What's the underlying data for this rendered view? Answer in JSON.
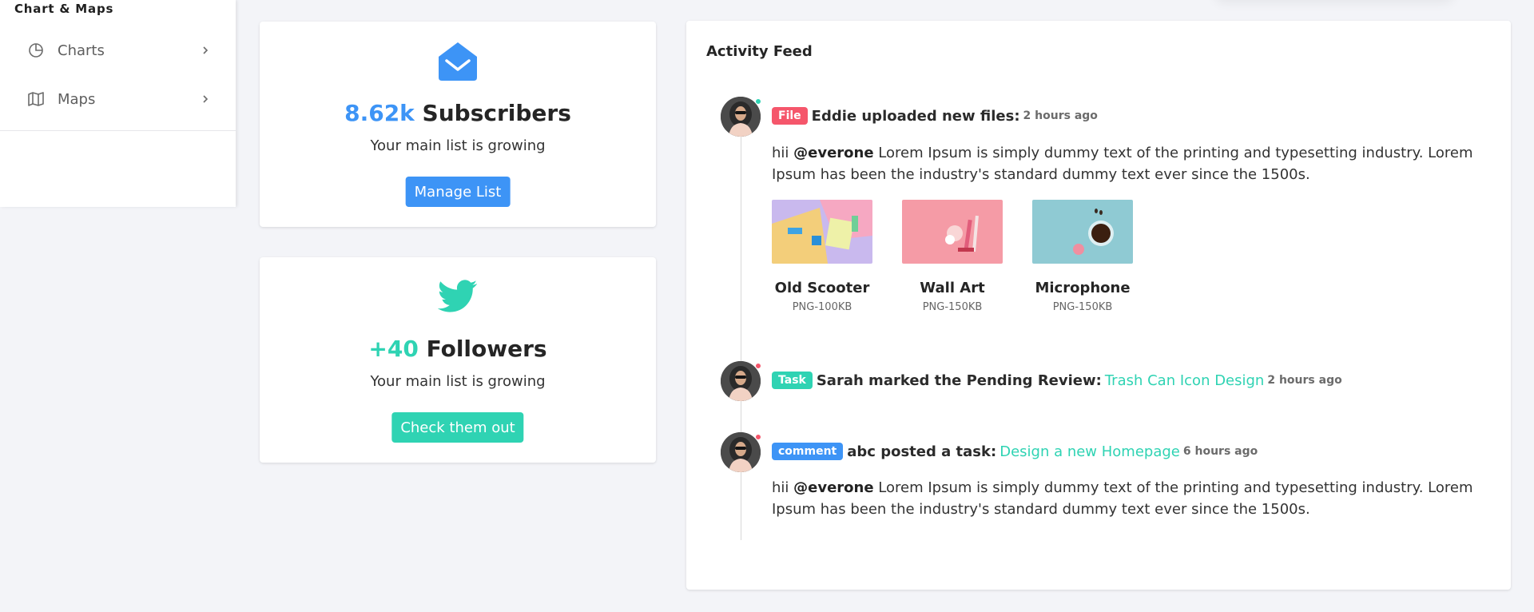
{
  "sidebar": {
    "section_title": "Chart & Maps",
    "items": [
      {
        "label": "Charts",
        "icon": "pie-chart-icon"
      },
      {
        "label": "Maps",
        "icon": "map-icon"
      }
    ]
  },
  "subscribers_card": {
    "icon": "envelope-open-icon",
    "count": "8.62k",
    "count_label": " Subscribers",
    "subtitle": "Your main list is growing",
    "button_label": "Manage List"
  },
  "followers_card": {
    "icon": "twitter-icon",
    "count": "+40",
    "count_label": " Followers",
    "subtitle": "Your main list is growing",
    "button_label": "Check them out"
  },
  "activity_feed": {
    "title": "Activity Feed",
    "entries": [
      {
        "badge": "File",
        "title": "Eddie uploaded new files:",
        "time": "2 hours ago",
        "mention_prefix": "hii ",
        "mention": "@everone",
        "text": " Lorem Ipsum is simply dummy text of the printing and typesetting industry. Lorem Ipsum has been the industry's standard dummy text ever since the 1500s.",
        "files": [
          {
            "name": "Old Scooter",
            "meta": "PNG-100KB"
          },
          {
            "name": "Wall Art",
            "meta": "PNG-150KB"
          },
          {
            "name": "Microphone",
            "meta": "PNG-150KB"
          }
        ]
      },
      {
        "badge": "Task",
        "title": "Sarah marked the Pending Review:",
        "link": "Trash Can Icon Design",
        "time": "2 hours ago"
      },
      {
        "badge": "comment",
        "title": "abc posted a task:",
        "link": "Design a new Homepage",
        "time": "6 hours ago",
        "mention_prefix": "hii ",
        "mention": "@everone",
        "text": " Lorem Ipsum is simply dummy text of the printing and typesetting industry. Lorem Ipsum has been the industry's standard dummy text ever since the 1500s."
      }
    ]
  },
  "colors": {
    "primary": "#3d94f6",
    "accent": "#2fd3b3",
    "danger": "#f5566b",
    "background": "#f3f4f8"
  }
}
